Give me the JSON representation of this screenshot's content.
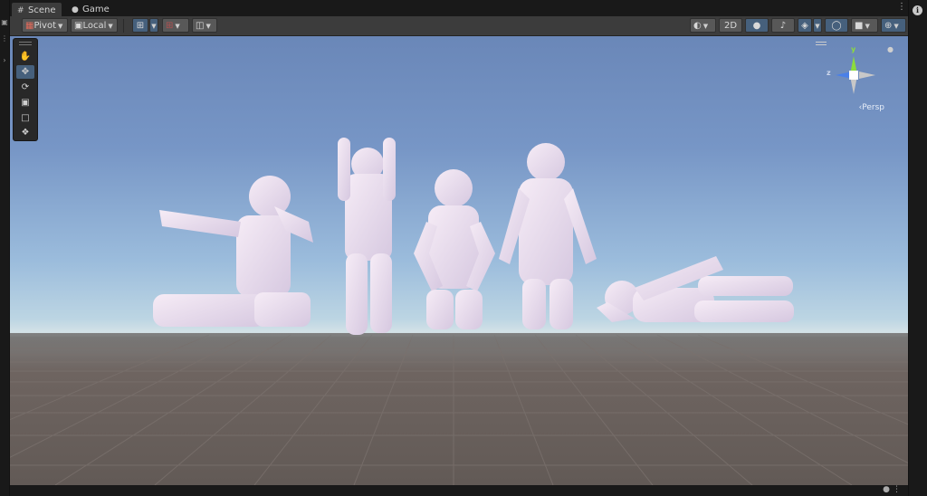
{
  "tabs": [
    {
      "icon": "hash-icon",
      "label": "Scene",
      "active": true
    },
    {
      "icon": "gamepad-icon",
      "label": "Game",
      "active": false
    }
  ],
  "toolbar": {
    "pivot_label": "Pivot",
    "local_label": "Local",
    "twod_label": "2D"
  },
  "gizmo": {
    "y_label": "y",
    "z_label": "z",
    "persp_label": "‹Persp"
  },
  "tools": [
    "hand-tool-icon",
    "move-tool-icon",
    "rotate-tool-icon",
    "scale-tool-icon",
    "rect-tool-icon",
    "transform-tool-icon"
  ],
  "colors": {
    "accent_active": "#46607c",
    "figure_color": "#f0e4f0",
    "sky_top": "#6a87b8",
    "ground": "#625a56",
    "gizmo_y": "#8cdc3c",
    "gizmo_x": "#e04040",
    "gizmo_z": "#4a80e8"
  }
}
